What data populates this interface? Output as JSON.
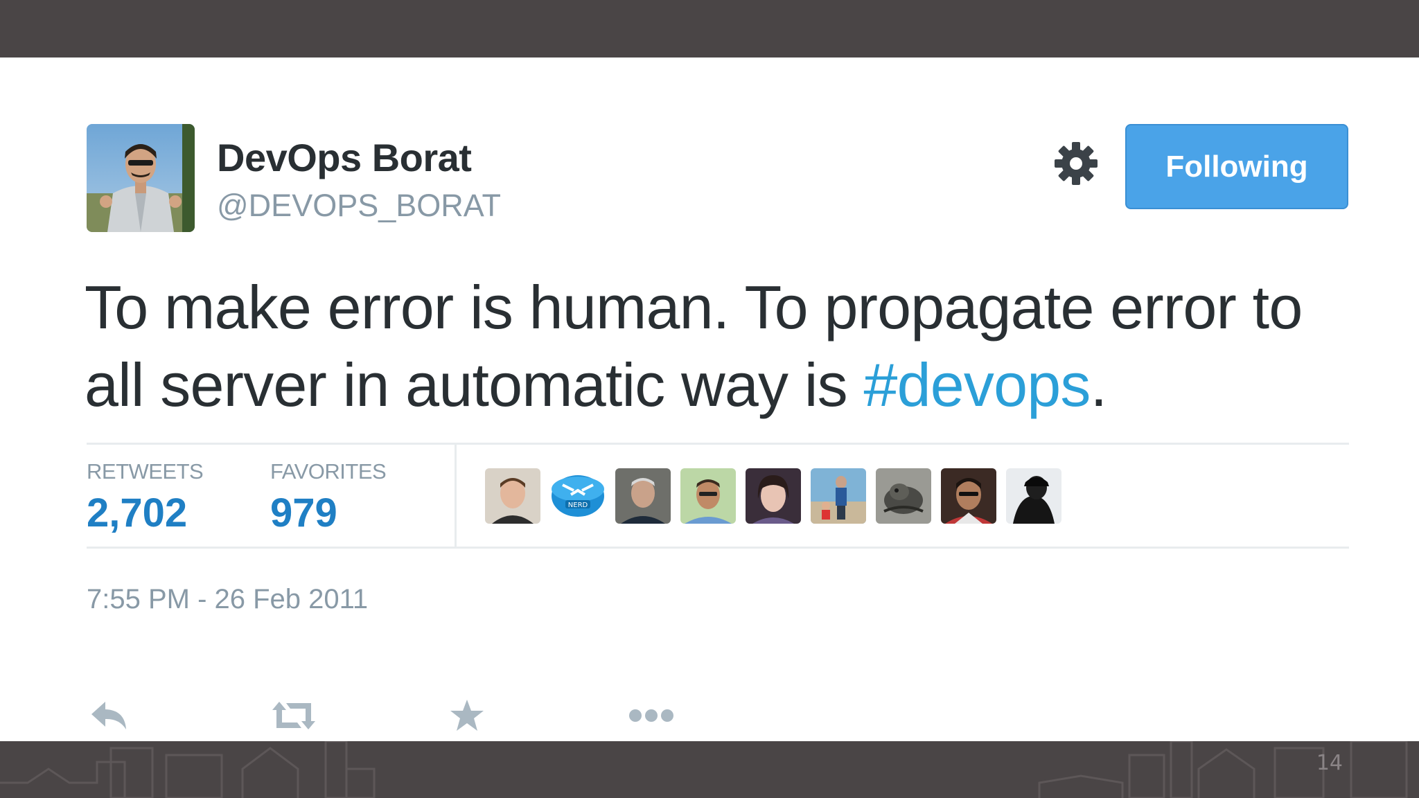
{
  "tweet": {
    "author": {
      "name": "DevOps Borat",
      "handle": "@DEVOPS_BORAT"
    },
    "follow_button_label": "Following",
    "text_before": "To make error is human. To propagate error to all server in automatic way is ",
    "hashtag": "#devops",
    "text_after": ".",
    "stats": {
      "retweets_label": "RETWEETS",
      "retweets_value": "2,702",
      "favorites_label": "FAVORITES",
      "favorites_value": "979"
    },
    "favoriters_count_shown": 9,
    "timestamp": "7:55 PM - 26 Feb 2011",
    "actions": [
      "reply-icon",
      "retweet-icon",
      "favorite-icon",
      "more-icon"
    ]
  },
  "slide": {
    "number": "14"
  },
  "colors": {
    "follow_button": "#4aa3e8",
    "hashtag": "#2b9fd8",
    "stat_value": "#1f7fc4",
    "muted_text": "#8899a6",
    "frame": "#4a4546"
  }
}
